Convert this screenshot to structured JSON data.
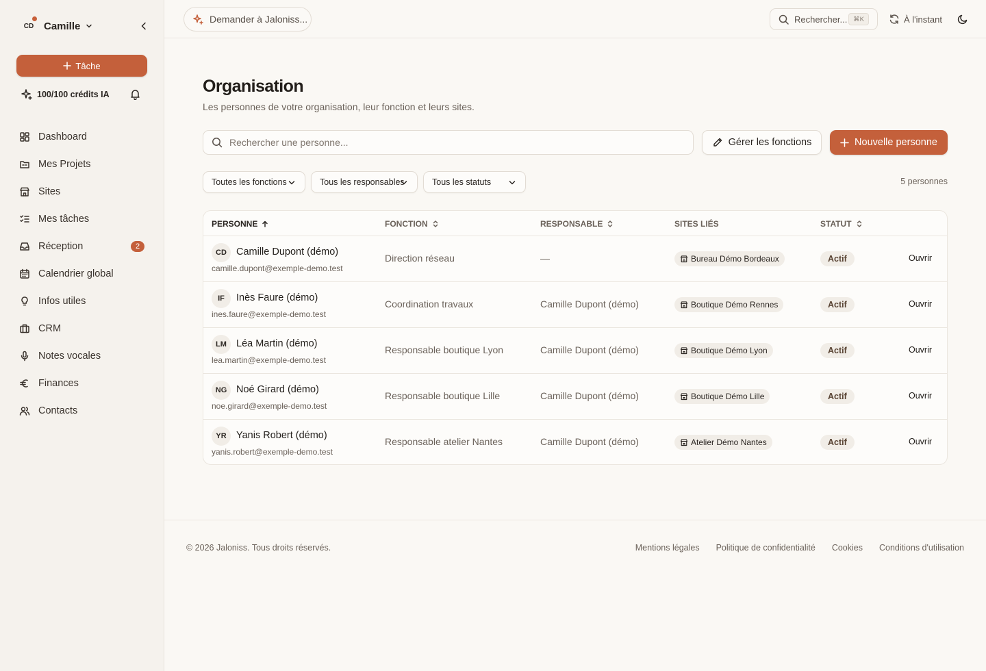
{
  "sidebar": {
    "user_initials": "CD",
    "user_name": "Camille",
    "task_button": "Tâche",
    "credits": "100/100 crédits IA",
    "items": [
      {
        "label": "Dashboard",
        "icon": "dashboard-icon"
      },
      {
        "label": "Mes Projets",
        "icon": "folder-icon"
      },
      {
        "label": "Sites",
        "icon": "store-icon"
      },
      {
        "label": "Mes tâches",
        "icon": "checklist-icon"
      },
      {
        "label": "Réception",
        "icon": "inbox-icon",
        "badge": "2"
      },
      {
        "label": "Calendrier global",
        "icon": "calendar-icon"
      },
      {
        "label": "Infos utiles",
        "icon": "lightbulb-icon"
      },
      {
        "label": "CRM",
        "icon": "briefcase-icon"
      },
      {
        "label": "Notes vocales",
        "icon": "microphone-icon"
      },
      {
        "label": "Finances",
        "icon": "euro-icon"
      },
      {
        "label": "Contacts",
        "icon": "users-icon"
      }
    ]
  },
  "topbar": {
    "ask_placeholder": "Demander à Jaloniss...",
    "search_label": "Rechercher...",
    "search_shortcut": "⌘K",
    "sync_label": "À l'instant"
  },
  "main": {
    "title": "Organisation",
    "subtitle": "Les personnes de votre organisation, leur fonction et leurs sites.",
    "search_placeholder": "Rechercher une personne...",
    "manage_button": "Gérer les fonctions",
    "new_button": "Nouvelle personne",
    "filters": [
      "Toutes les fonctions",
      "Tous les responsables",
      "Tous les statuts"
    ],
    "count": "5 personnes"
  },
  "table": {
    "headers": {
      "person": "Personne",
      "function": "Fonction",
      "manager": "Responsable",
      "sites": "Sites liés",
      "status": "Statut"
    },
    "rows": [
      {
        "initials": "CD",
        "name": "Camille Dupont (démo)",
        "email": "camille.dupont@exemple-demo.test",
        "function": "Direction réseau",
        "manager": "—",
        "site": "Bureau Démo Bordeaux",
        "status": "Actif",
        "action": "Ouvrir"
      },
      {
        "initials": "IF",
        "name": "Inès Faure (démo)",
        "email": "ines.faure@exemple-demo.test",
        "function": "Coordination travaux",
        "manager": "Camille Dupont (démo)",
        "site": "Boutique Démo Rennes",
        "status": "Actif",
        "action": "Ouvrir"
      },
      {
        "initials": "LM",
        "name": "Léa Martin (démo)",
        "email": "lea.martin@exemple-demo.test",
        "function": "Responsable boutique Lyon",
        "manager": "Camille Dupont (démo)",
        "site": "Boutique Démo Lyon",
        "status": "Actif",
        "action": "Ouvrir"
      },
      {
        "initials": "NG",
        "name": "Noé Girard (démo)",
        "email": "noe.girard@exemple-demo.test",
        "function": "Responsable boutique Lille",
        "manager": "Camille Dupont (démo)",
        "site": "Boutique Démo Lille",
        "status": "Actif",
        "action": "Ouvrir"
      },
      {
        "initials": "YR",
        "name": "Yanis Robert (démo)",
        "email": "yanis.robert@exemple-demo.test",
        "function": "Responsable atelier Nantes",
        "manager": "Camille Dupont (démo)",
        "site": "Atelier Démo Nantes",
        "status": "Actif",
        "action": "Ouvrir"
      }
    ]
  },
  "footer": {
    "copyright": "© 2026 Jaloniss. Tous droits réservés.",
    "links": [
      "Mentions légales",
      "Politique de confidentialité",
      "Cookies",
      "Conditions d'utilisation"
    ]
  },
  "colors": {
    "accent": "#c4603b",
    "background": "#faf8f4",
    "sidebar": "#f5f2ed"
  }
}
